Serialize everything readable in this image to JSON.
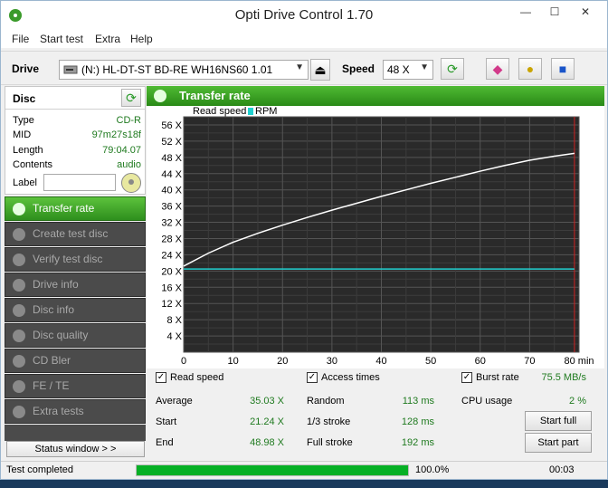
{
  "window": {
    "title": "Opti Drive Control 1.70",
    "minimize": "—",
    "maximize": "☐",
    "close": "✕"
  },
  "menu": [
    "File",
    "Start test",
    "Extra",
    "Help"
  ],
  "toolbar": {
    "drive_label": "Drive",
    "drive_value": "(N:)  HL-DT-ST BD-RE  WH16NS60 1.01",
    "speed_label": "Speed",
    "speed_value": "48 X"
  },
  "disc": {
    "header": "Disc",
    "rows": [
      {
        "key": "Type",
        "value": "CD-R"
      },
      {
        "key": "MID",
        "value": "97m27s18f"
      },
      {
        "key": "Length",
        "value": "79:04.07"
      },
      {
        "key": "Contents",
        "value": "audio"
      }
    ],
    "label_key": "Label",
    "label_value": ""
  },
  "nav": [
    "Transfer rate",
    "Create test disc",
    "Verify test disc",
    "Drive info",
    "Disc info",
    "Disc quality",
    "CD Bler",
    "FE / TE",
    "Extra tests"
  ],
  "nav_active_index": 0,
  "status_window_button": "Status window > >",
  "panel_title": "Transfer rate",
  "chart_data": {
    "type": "line",
    "legend": [
      "Read speed",
      "RPM"
    ],
    "x_ticks": [
      "0",
      "10",
      "20",
      "30",
      "40",
      "50",
      "60",
      "70",
      "80 min"
    ],
    "y_ticks": [
      "4 X",
      "8 X",
      "12 X",
      "16 X",
      "20 X",
      "24 X",
      "28 X",
      "32 X",
      "36 X",
      "40 X",
      "44 X",
      "48 X",
      "52 X",
      "56 X"
    ],
    "xlim": [
      0,
      80
    ],
    "ylim": [
      0,
      58
    ],
    "end_marker_x": 79.07,
    "series": [
      {
        "name": "Read speed",
        "color": "#ffffff",
        "x": [
          0,
          5,
          10,
          15,
          20,
          25,
          30,
          35,
          40,
          45,
          50,
          55,
          60,
          65,
          70,
          75,
          79.07
        ],
        "values": [
          21.2,
          24.4,
          27.1,
          29.3,
          31.3,
          33.2,
          35.0,
          36.7,
          38.4,
          40.0,
          41.6,
          43.1,
          44.6,
          46.0,
          47.3,
          48.3,
          49.0
        ]
      },
      {
        "name": "RPM",
        "color": "#20d0d0",
        "x": [
          0,
          79.07
        ],
        "values": [
          20.5,
          20.5
        ]
      }
    ],
    "grid": true,
    "background": "#2a2a2a"
  },
  "stats": {
    "read_speed_label": "Read speed",
    "access_times_label": "Access times",
    "burst_rate_label": "Burst rate",
    "burst_rate_value": "75.5 MB/s",
    "average_label": "Average",
    "average_value": "35.03 X",
    "start_label": "Start",
    "start_value": "21.24 X",
    "end_label": "End",
    "end_value": "48.98 X",
    "random_label": "Random",
    "random_value": "113 ms",
    "stroke13_label": "1/3 stroke",
    "stroke13_value": "128 ms",
    "full_stroke_label": "Full stroke",
    "full_stroke_value": "192 ms",
    "cpu_label": "CPU usage",
    "cpu_value": "2 %",
    "start_full_button": "Start full",
    "start_part_button": "Start part"
  },
  "statusbar": {
    "text": "Test completed",
    "progress": 1.0,
    "percent": "100.0%",
    "time": "00:03"
  }
}
